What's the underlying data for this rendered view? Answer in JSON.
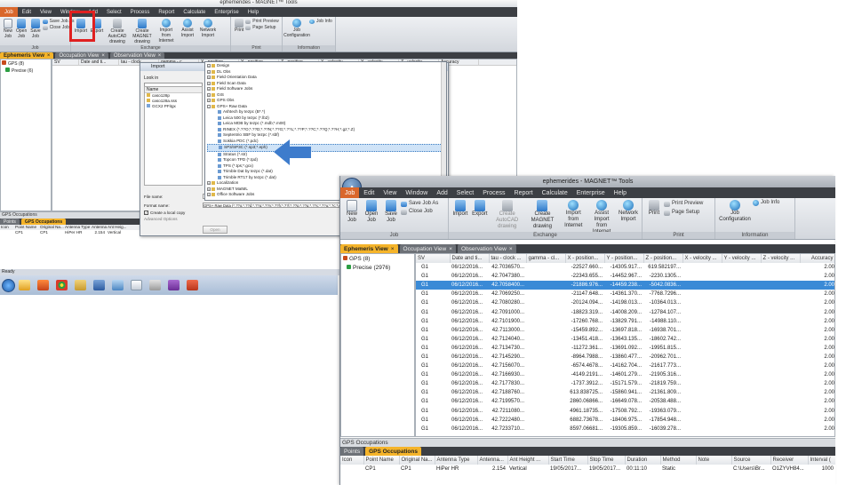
{
  "small_window": {
    "title": "ephemerides - MAGNET™ Tools",
    "menu": [
      "Job",
      "Edit",
      "View",
      "Window",
      "Add",
      "Select",
      "Process",
      "Report",
      "Calculate",
      "Enterprise",
      "Help"
    ],
    "ribbon_small": {
      "new_job": "New Job",
      "open_job": "Open Job",
      "save_job": "Save Job",
      "save_job_as": "Save Job As",
      "close_job": "Close Job",
      "group_job": "Job",
      "import": "Import",
      "export": "Export",
      "create_autocad": "Create AutoCAD drawing",
      "create_magnet": "Create MAGNET drawing",
      "import_internet": "Import from Internet",
      "assist_import": "Assist Import",
      "network_import": "Network Import",
      "group_exchange": "Exchange",
      "print": "Print",
      "print_preview": "Print Preview",
      "page_setup": "Page Setup",
      "group_print": "Print",
      "job_config": "Job Configuration",
      "job_info": "Job Info",
      "group_info": "Information"
    },
    "tabs": [
      "Ephemeris View",
      "Occupation View",
      "Observation View"
    ],
    "tree": [
      "GPS (8)",
      "Precise (6)"
    ],
    "columns": [
      "SV",
      "Date and ti...",
      "tau - clock...",
      "gamma - c...",
      "X - position...",
      "Y - position...",
      "Z - position...",
      "X - velocity...",
      "Y - velocity...",
      "Z - velocity...",
      "Accuracy"
    ],
    "occupations_title": "GPS Occupations",
    "occ_tabs": [
      "Points",
      "GPS Occupations"
    ],
    "occ_columns": [
      "Icon",
      "Point Name",
      "Original Na...",
      "Antenna Type",
      "Antenna...",
      "Ant Heig..."
    ],
    "occ_row": [
      "",
      "CP1",
      "CP1",
      "HiPer HR",
      "2.154",
      "Vertical"
    ],
    "status": "Ready"
  },
  "import_dialog": {
    "title": "Import",
    "look_in": "Look in",
    "name_header": "Name",
    "files": [
      "caso128p",
      "caso128a.sss",
      "GCX2 PFitgx"
    ],
    "file_name_label": "File name:",
    "format_label": "Format name:",
    "format_value": "GPS+ Raw Data (*.??o;*.??d;*.??g;*.??n;*.??h;*.??l;*.??p;*.??q;*.??c;*.??u;*.?c;*.eph;*.dat;*.gz;*.gps;*.tps;*.gcx;*.pdc;*.tps)",
    "create_copy": "Create a local copy",
    "advanced": "Advanced Options",
    "open_button": "Open"
  },
  "format_list": [
    {
      "label": "Design",
      "level": 0,
      "expand": "+"
    },
    {
      "label": "DL Obs",
      "level": 0,
      "expand": "+"
    },
    {
      "label": "Field Orientation Data",
      "level": 0,
      "expand": "+"
    },
    {
      "label": "Field Scan Data",
      "level": 0,
      "expand": "+"
    },
    {
      "label": "Field Software Jobs",
      "level": 0,
      "expand": "+"
    },
    {
      "label": "GIS",
      "level": 0,
      "expand": "+"
    },
    {
      "label": "GPS Obs",
      "level": 0,
      "expand": "+"
    },
    {
      "label": "GPS+ Raw Data",
      "level": 0,
      "expand": "−"
    },
    {
      "label": "Ashtech by tezpc (B*.*)",
      "level": 1,
      "expand": ""
    },
    {
      "label": "Leica 500 by tezpc (*.lb2)",
      "level": 1,
      "expand": ""
    },
    {
      "label": "Leica MDB by tezpc (*.mdb;*.m00)",
      "level": 1,
      "expand": ""
    },
    {
      "label": "RINEX (*.??O;*.??D;*.??N;*.??G;*.??L;*.??P;*.??C;*.??Q;*.??H;*.gz;*.Z)",
      "level": 1,
      "expand": ""
    },
    {
      "label": "Septentrio SBF by tezpc (*.sbf)",
      "level": 1,
      "expand": ""
    },
    {
      "label": "Sokkia PDC (*.pdc)",
      "level": 1,
      "expand": ""
    },
    {
      "label": "SP3/SP3C (*.sp3;*.eph)",
      "level": 1,
      "expand": "",
      "selected": true
    },
    {
      "label": "Stratus (*.str)",
      "level": 1,
      "expand": ""
    },
    {
      "label": "Topcon TPD (*.tpd)",
      "level": 1,
      "expand": ""
    },
    {
      "label": "TPS (*.tps;*.gcx)",
      "level": 1,
      "expand": ""
    },
    {
      "label": "Trimble Dat by tezpc (*.dat)",
      "level": 1,
      "expand": ""
    },
    {
      "label": "Trimble RT17 by tezpc (*.dat)",
      "level": 1,
      "expand": ""
    },
    {
      "label": "Localization",
      "level": 0,
      "expand": "+"
    },
    {
      "label": "MAGNET MatML",
      "level": 0,
      "expand": "+"
    },
    {
      "label": "Office Software Jobs",
      "level": 0,
      "expand": "+"
    }
  ],
  "big_window": {
    "title": "ephemerides - MAGNET™ Tools",
    "menu": [
      "Job",
      "Edit",
      "View",
      "Window",
      "Add",
      "Select",
      "Process",
      "Report",
      "Calculate",
      "Enterprise",
      "Help"
    ],
    "ribbon": {
      "new_job": "New Job",
      "open_job": "Open Job",
      "save_job": "Save Job",
      "save_job_as": "Save Job As",
      "close_job": "Close Job",
      "group_job": "Job",
      "import": "Import",
      "export": "Export",
      "create_autocad": "Create AutoCAD drawing",
      "create_magnet": "Create MAGNET drawing",
      "import_internet": "Import from Internet",
      "assist_import": "Assist Import from Internet",
      "network_import": "Network Import",
      "group_exchange": "Exchange",
      "print": "Print",
      "print_preview": "Print Preview",
      "page_setup": "Page Setup",
      "group_print": "Print",
      "job_config": "Job Configuration",
      "job_info": "Job Info",
      "group_info": "Information"
    },
    "tabs": [
      "Ephemeris View",
      "Occupation View",
      "Observation View"
    ],
    "tree": [
      "GPS (8)",
      "Precise (2976)"
    ],
    "columns": [
      "SV",
      "Date and ti...",
      "tau - clock ...",
      "gamma - cl...",
      "X - position...",
      "Y - position...",
      "Z - position...",
      "X - velocity ...",
      "Y - velocity ...",
      "Z - velocity ...",
      "Accuracy"
    ],
    "rows": [
      [
        "G1",
        "06/12/2016...",
        "42.7036570...",
        "",
        "-22527.660...",
        "-14305.917...",
        "619.582197...",
        "",
        "",
        "",
        "2.00"
      ],
      [
        "G1",
        "06/12/2016...",
        "42.7047380...",
        "",
        "-22343.655...",
        "-14452.967...",
        "-2230.1305...",
        "",
        "",
        "",
        "2.00"
      ],
      [
        "G1",
        "06/12/2016...",
        "42.7058400...",
        "",
        "-21886.976...",
        "-14459.238...",
        "-5042.0836...",
        "",
        "",
        "",
        "2.00"
      ],
      [
        "G1",
        "06/12/2016...",
        "42.7069250...",
        "",
        "-21147.648...",
        "-14361.370...",
        "-7768.7296...",
        "",
        "",
        "",
        "2.00"
      ],
      [
        "G1",
        "06/12/2016...",
        "42.7080280...",
        "",
        "-20124.094...",
        "-14198.013...",
        "-10364.013...",
        "",
        "",
        "",
        "2.00"
      ],
      [
        "G1",
        "06/12/2016...",
        "42.7091000...",
        "",
        "-18823.319...",
        "-14008.209...",
        "-12784.107...",
        "",
        "",
        "",
        "2.00"
      ],
      [
        "G1",
        "06/12/2016...",
        "42.7101900...",
        "",
        "-17260.768...",
        "-13829.791...",
        "-14988.110...",
        "",
        "",
        "",
        "2.00"
      ],
      [
        "G1",
        "06/12/2016...",
        "42.7113000...",
        "",
        "-15459.892...",
        "-13697.818...",
        "-16938.701...",
        "",
        "",
        "",
        "2.00"
      ],
      [
        "G1",
        "06/12/2016...",
        "42.7124040...",
        "",
        "-13451.418...",
        "-13643.135...",
        "-18602.742...",
        "",
        "",
        "",
        "2.00"
      ],
      [
        "G1",
        "06/12/2016...",
        "42.7134730...",
        "",
        "-11272.361...",
        "-13691.092...",
        "-19951.815...",
        "",
        "",
        "",
        "2.00"
      ],
      [
        "G1",
        "06/12/2016...",
        "42.7145290...",
        "",
        "-8964.7988...",
        "-13860.477...",
        "-20962.701...",
        "",
        "",
        "",
        "2.00"
      ],
      [
        "G1",
        "06/12/2016...",
        "42.7156070...",
        "",
        "-6574.4678...",
        "-14162.704...",
        "-21617.773...",
        "",
        "",
        "",
        "2.00"
      ],
      [
        "G1",
        "06/12/2016...",
        "42.7166930...",
        "",
        "-4149.2191...",
        "-14601.279...",
        "-21905.316...",
        "",
        "",
        "",
        "2.00"
      ],
      [
        "G1",
        "06/12/2016...",
        "42.7177830...",
        "",
        "-1737.3912...",
        "-15171.579...",
        "-21819.759...",
        "",
        "",
        "",
        "2.00"
      ],
      [
        "G1",
        "06/12/2016...",
        "42.7188760...",
        "",
        "613.838725...",
        "-15860.941...",
        "-21361.809...",
        "",
        "",
        "",
        "2.00"
      ],
      [
        "G1",
        "06/12/2016...",
        "42.7199570...",
        "",
        "2860.06866...",
        "-16649.078...",
        "-20538.488...",
        "",
        "",
        "",
        "2.00"
      ],
      [
        "G1",
        "06/12/2016...",
        "42.7211080...",
        "",
        "4961.18735...",
        "-17508.792...",
        "-19363.079...",
        "",
        "",
        "",
        "2.00"
      ],
      [
        "G1",
        "06/12/2016...",
        "42.7222480...",
        "",
        "6882.73678...",
        "-18406.975...",
        "-17854.948...",
        "",
        "",
        "",
        "2.00"
      ],
      [
        "G1",
        "06/12/2016...",
        "42.7233710...",
        "",
        "8597.06681...",
        "-19305.859...",
        "-16039.278...",
        "",
        "",
        "",
        "2.00"
      ]
    ],
    "selected_row": 2,
    "occupations_title": "GPS Occupations",
    "occ_tabs": [
      "Points",
      "GPS Occupations"
    ],
    "occ_columns": [
      "Icon",
      "Point Name",
      "Original Na...",
      "Antenna Type",
      "Antenna...",
      "Ant Height ...",
      "Start Time",
      "Stop Time",
      "Duration",
      "Method",
      "Note",
      "Source",
      "Receiver",
      "Interval ("
    ],
    "occ_row": [
      "",
      "CP1",
      "CP1",
      "HiPer HR",
      "2.154",
      "Vertical",
      "19/05/2017...",
      "19/05/2017...",
      "00:11:10",
      "Static",
      "",
      "C:\\Users\\Br...",
      "O1ZYVH84...",
      "1000"
    ]
  },
  "colors": {
    "accent": "#d9672c",
    "tab_active": "#f5b42a",
    "selection": "#3a8ad6",
    "highlight_box": "#e02020",
    "arrow": "#3e7ccc"
  }
}
